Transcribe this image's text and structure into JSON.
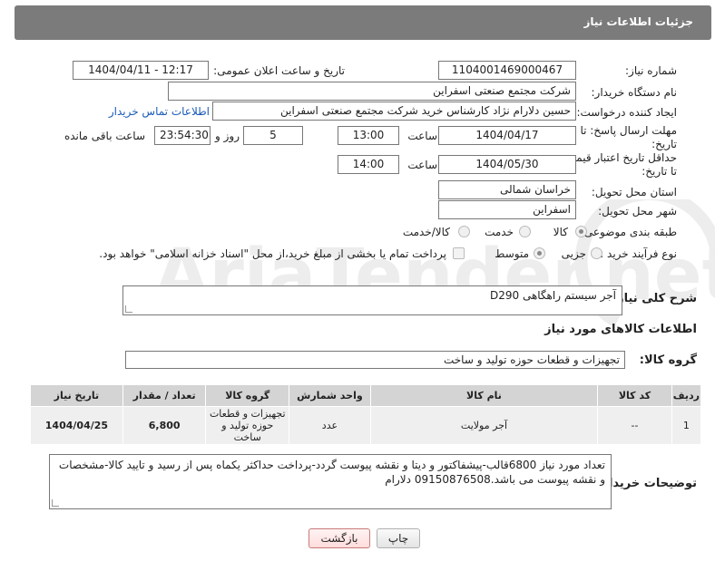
{
  "header": {
    "title": "جزئیات اطلاعات نیاز"
  },
  "form": {
    "need_number": {
      "label": "شماره نیاز:",
      "value": "1104001469000467"
    },
    "announce_datetime": {
      "label": "تاریخ و ساعت اعلان عمومی:",
      "value": "1404/04/11 - 12:17"
    },
    "buyer_org": {
      "label": "نام دستگاه خریدار:",
      "value": "شرکت مجتمع صنعتی اسفراین"
    },
    "requester": {
      "label": "ایجاد کننده درخواست:",
      "value": "حسین دلارام نژاد کارشناس خرید شرکت مجتمع صنعتی اسفراین",
      "contact_link": "اطلاعات تماس خریدار"
    },
    "reply_deadline": {
      "label_line1": "مهلت ارسال پاسخ: تا",
      "label_line2": "تاریخ:",
      "date": "1404/04/17",
      "time_label": "ساعت",
      "time": "13:00",
      "days": "5",
      "days_label": "روز و",
      "remaining": "23:54:30",
      "remaining_label": "ساعت باقی مانده"
    },
    "price_validity": {
      "label_line1": "حداقل تاریخ اعتبار قیمت:",
      "label_line2": "تا تاریخ:",
      "date": "1404/05/30",
      "time_label": "ساعت",
      "time": "14:00"
    },
    "delivery_province": {
      "label": "استان محل تحویل:",
      "value": "خراسان شمالی"
    },
    "delivery_city": {
      "label": "شهر محل تحویل:",
      "value": "اسفراین"
    },
    "category": {
      "label": "طبقه بندی موضوعی:",
      "options": [
        "کالا",
        "خدمت",
        "کالا/خدمت"
      ],
      "selected": "کالا"
    },
    "process_type": {
      "label": "نوع فرآیند خرید :",
      "options": [
        "جزیی",
        "متوسط"
      ],
      "selected": "متوسط",
      "payment_note": "پرداخت تمام یا بخشی از مبلغ خرید،از محل \"اسناد خزانه اسلامی\" خواهد بود."
    }
  },
  "summary": {
    "label": "شرح کلی نیاز:",
    "value": "آجر سیستم راهگاهی D290"
  },
  "goods_info": {
    "section_title": "اطلاعات کالاهای مورد نیاز",
    "group_label": "گروه کالا:",
    "group_value": "تجهیزات و قطعات حوزه تولید و ساخت"
  },
  "table": {
    "headers": [
      "ردیف",
      "کد کالا",
      "نام کالا",
      "واحد شمارش",
      "گروه کالا",
      "تعداد / مقدار",
      "تاریخ نیاز"
    ],
    "rows": [
      {
        "row": "1",
        "code": "--",
        "name": "آجر مولایت",
        "unit": "عدد",
        "group": "تجهیزات و قطعات حوزه تولید و ساخت",
        "qty": "6,800",
        "date": "1404/04/25"
      }
    ]
  },
  "buyer_notes": {
    "label": "توضیحات خریدار:",
    "value": "تعداد مورد نیاز 6800قالب-پیشفاکتور و دیتا و نقشه پیوست گردد-پرداخت حداکثر یکماه پس از رسید و تایید کالا-مشخصات و نقشه پیوست می باشد.09150876508 دلارام"
  },
  "buttons": {
    "print": "چاپ",
    "back": "بازگشت"
  },
  "watermark_text": "AriaTender.net"
}
